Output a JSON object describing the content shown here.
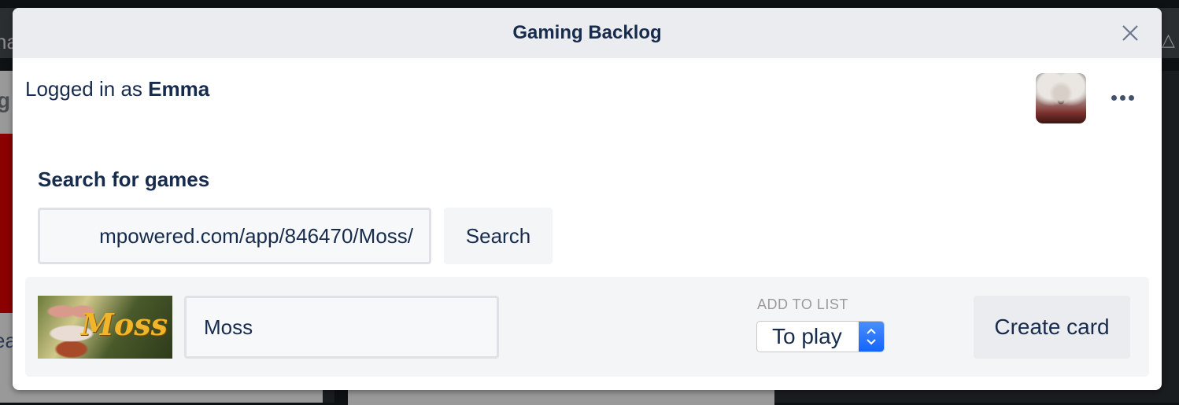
{
  "background": {
    "topbar_partial_text": "na",
    "left_column_partial_text": "g",
    "left_column_bottom_partial_text": "ea"
  },
  "modal": {
    "title": "Gaming Backlog",
    "close_icon": "close-icon",
    "user": {
      "prefix": "Logged in as ",
      "name": "Emma",
      "avatar_icon": "avatar-image"
    },
    "more_menu_icon": "more-horizontal-icon",
    "search": {
      "label": "Search for games",
      "input_value": "mpowered.com/app/846470/Moss/",
      "button_label": "Search"
    },
    "result": {
      "thumbnail_title": "Moss",
      "game_name_value": "Moss",
      "add_to_list_label": "ADD TO LIST",
      "list_selected": "To play",
      "create_button_label": "Create card"
    }
  }
}
